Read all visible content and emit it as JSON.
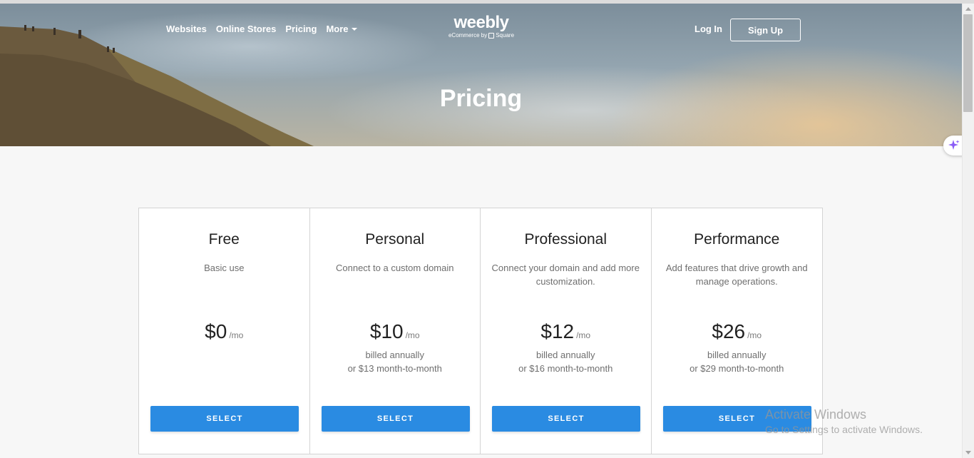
{
  "header": {
    "nav": [
      "Websites",
      "Online Stores",
      "Pricing",
      "More"
    ],
    "logo": {
      "wordmark": "weebly",
      "tagline_prefix": "eCommerce by",
      "tagline_brand": "Square"
    },
    "login_label": "Log In",
    "signup_label": "Sign Up",
    "hero_title": "Pricing"
  },
  "plans": [
    {
      "name": "Free",
      "description": "Basic use",
      "price": "$0",
      "period": "/mo",
      "billing_line1": "",
      "billing_line2": "",
      "button": "SELECT"
    },
    {
      "name": "Personal",
      "description": "Connect to a custom domain",
      "price": "$10",
      "period": "/mo",
      "billing_line1": "billed annually",
      "billing_line2": "or $13 month-to-month",
      "button": "SELECT"
    },
    {
      "name": "Professional",
      "description": "Connect your domain and add more customization.",
      "price": "$12",
      "period": "/mo",
      "billing_line1": "billed annually",
      "billing_line2": "or $16 month-to-month",
      "button": "SELECT"
    },
    {
      "name": "Performance",
      "description": "Add features that drive growth and manage operations.",
      "price": "$26",
      "period": "/mo",
      "billing_line1": "billed annually",
      "billing_line2": "or $29 month-to-month",
      "button": "SELECT"
    }
  ],
  "watermark": {
    "title": "Activate Windows",
    "subtitle": "Go to Settings to activate Windows."
  },
  "icons": {
    "more_caret": "chevron-down-icon",
    "square_logo": "square-icon",
    "ai_assistant": "sparkle-icon"
  },
  "colors": {
    "select_button": "#2a8be2",
    "page_background": "#f7f7f7",
    "ai_icon": "#8a5cf6"
  }
}
